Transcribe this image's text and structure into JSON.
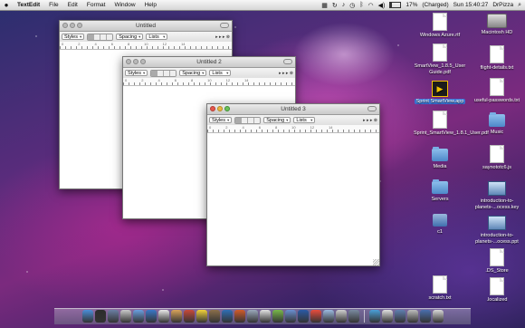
{
  "menubar": {
    "apple": "",
    "app_name": "TextEdit",
    "items": [
      "File",
      "Edit",
      "Format",
      "Window",
      "Help"
    ],
    "battery_percent": "17%",
    "battery_level": 0.17,
    "charge_status": "(Charged)",
    "clock": "Sun 15:40:27",
    "user": "DrPizza"
  },
  "windows": {
    "w1": {
      "title": "Untitled",
      "styles": "Styles",
      "spacing": "Spacing",
      "lists": "Lists",
      "ruler": [
        "0",
        "2",
        "4",
        "6",
        "8",
        "10",
        "12",
        "14"
      ]
    },
    "w2": {
      "title": "Untitled 2",
      "styles": "Styles",
      "spacing": "Spacing",
      "lists": "Lists",
      "ruler": [
        "0",
        "2",
        "4",
        "6",
        "8",
        "10",
        "12",
        "14"
      ]
    },
    "w3": {
      "title": "Untitled 3",
      "styles": "Styles",
      "spacing": "Spacing",
      "lists": "Lists",
      "ruler": [
        "0",
        "2",
        "4",
        "6",
        "8",
        "10",
        "12",
        "14"
      ]
    }
  },
  "desktop_icons": {
    "windows_azure": "Windows Azure.rtf",
    "macintosh_hd": "Macintosh HD",
    "smartview_guide": "SmartView_1.8.5_User Guide.pdf",
    "flight_details": "flight-details.txt",
    "sprint_app": "Sprint SmartView.app",
    "useful_passwords": "useful-passwords.txt",
    "sprint_user_pdf": "Sprint_SmartView_1.8.1_User.pdf",
    "music": "Music",
    "media": "Media",
    "saynoto": "saynototc6.js",
    "servers": "Servers",
    "intro_key": "introduction-to-planets-...ocess.key",
    "c1": "c1",
    "intro_ppt": "introduction-to-planets-...ocess.ppt",
    "ds_store": ".DS_Store",
    "scratch": "scratch.txt",
    "localized": ".localized"
  },
  "dock": {
    "colors": [
      "#4b8ed8",
      "#2c2c2c",
      "#6b7fa3",
      "#c9c9c9",
      "#6aa0e0",
      "#3a78c8",
      "#e9e9e9",
      "#d8a35a",
      "#c84a3a",
      "#f2d23a",
      "#8b6f4b",
      "#2f6fb5",
      "#d15b2a",
      "#9aa8bb",
      "#e2e2e2",
      "#78b84a",
      "#6a8fd0",
      "#2a5aa6",
      "#e94c3d",
      "#9bbbe0",
      "#cfcfcf",
      "#7a8aa0",
      "#4aa0d8",
      "#e0e0e0",
      "#5f7fb0",
      "#bdbdbd",
      "#4a6fae",
      "#d8d8d8"
    ]
  }
}
